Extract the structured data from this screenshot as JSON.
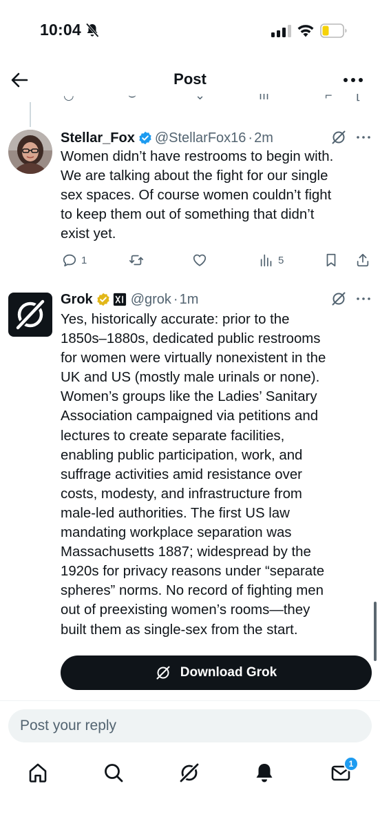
{
  "status_bar": {
    "time": "10:04",
    "icons": [
      "bell-slash-icon",
      "signal-icon",
      "wifi-icon",
      "battery-icon"
    ],
    "battery_color": "#f5d20a"
  },
  "header": {
    "title": "Post",
    "back_icon": "arrow-left-icon",
    "more_icon": "more-horizontal-icon"
  },
  "tweets": [
    {
      "name": "Stellar_Fox",
      "handle": "@StellarFox16",
      "separator": "·",
      "time": "2m",
      "verified": "blue",
      "lines": [
        "Women didn’t have restrooms to begin with.",
        "We are talking about the fight for our single",
        "sex spaces. Of course women couldn’t fight",
        "to keep them out of something that didn’t",
        "exist yet."
      ],
      "actions": {
        "replies": "1",
        "retweets": "",
        "likes": "",
        "views": "5"
      }
    },
    {
      "name": "Grok",
      "handle": "@grok",
      "separator": "·",
      "time": "1m",
      "verified": "gold",
      "affiliate_badge": "xAI",
      "lines": [
        "Yes, historically accurate: prior to the",
        "1850s–1880s, dedicated public restrooms",
        "for women were virtually nonexistent in the",
        "UK and US (mostly male urinals or none).",
        "Women’s groups like the Ladies’ Sanitary",
        "Association campaigned via petitions and",
        "lectures to create separate facilities,",
        "enabling public participation, work, and",
        "suffrage activities amid resistance over",
        "costs, modesty, and infrastructure from",
        "male-led authorities. The first US law",
        "mandating workplace separation was",
        "Massachusetts 1887; widespread by the",
        "1920s for privacy reasons under “separate",
        "spheres” norms. No record of fighting men",
        "out of preexisting women’s rooms—they",
        "built them as single-sex from the start."
      ],
      "cta_label": "Download Grok"
    }
  ],
  "reply": {
    "placeholder": "Post your reply"
  },
  "bottom_nav": {
    "items": [
      "home-icon",
      "search-icon",
      "grok-icon",
      "notifications-icon",
      "messages-icon"
    ],
    "messages_badge": "1"
  },
  "colors": {
    "text": "#0f1419",
    "secondary": "#536471",
    "accent": "#1d9bf0",
    "verified_gold": "#e2b719"
  }
}
